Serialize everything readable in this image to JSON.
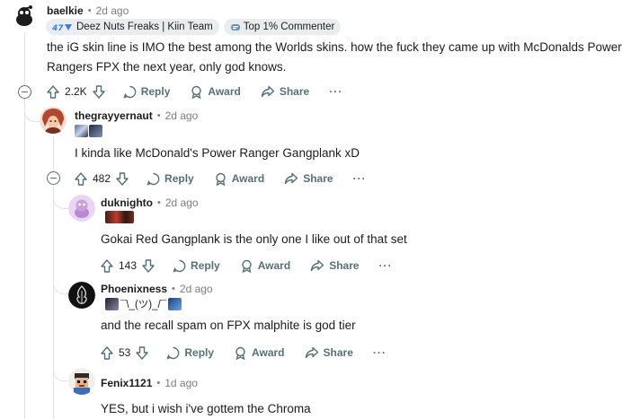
{
  "comments": [
    {
      "username": "baelkie",
      "time": "2d ago",
      "flairs": [
        "Deez Nuts Freaks | Kiin Team",
        "Top 1% Commenter"
      ],
      "body_lines": [
        "the iG skin line is IMO the best among the Worlds skins. how the fuck they came up with McDonalds Power",
        "Rangers FPX the next year, only god knows."
      ],
      "score": "2.2K"
    },
    {
      "username": "thegrayyernaut",
      "time": "2d ago",
      "body_lines": [
        "I kinda like McDonald's Power Ranger Gangplank xD"
      ],
      "score": "482"
    },
    {
      "username": "duknighto",
      "time": "2d ago",
      "body_lines": [
        "Gokai Red Gangplank is the only one I like out of that set"
      ],
      "score": "143"
    },
    {
      "username": "Phoenixness",
      "time": "2d ago",
      "flair_text": "¯\\_(ツ)_/¯",
      "body_lines": [
        "and the recall spam on FPX malphite is god tier"
      ],
      "score": "53"
    },
    {
      "username": "Fenix1121",
      "time": "1d ago",
      "body_lines": [
        "YES, but i wish i've gottem the Chroma"
      ]
    }
  ],
  "actions": {
    "reply": "Reply",
    "award": "Award",
    "share": "Share",
    "more": "···"
  },
  "separator": "•"
}
